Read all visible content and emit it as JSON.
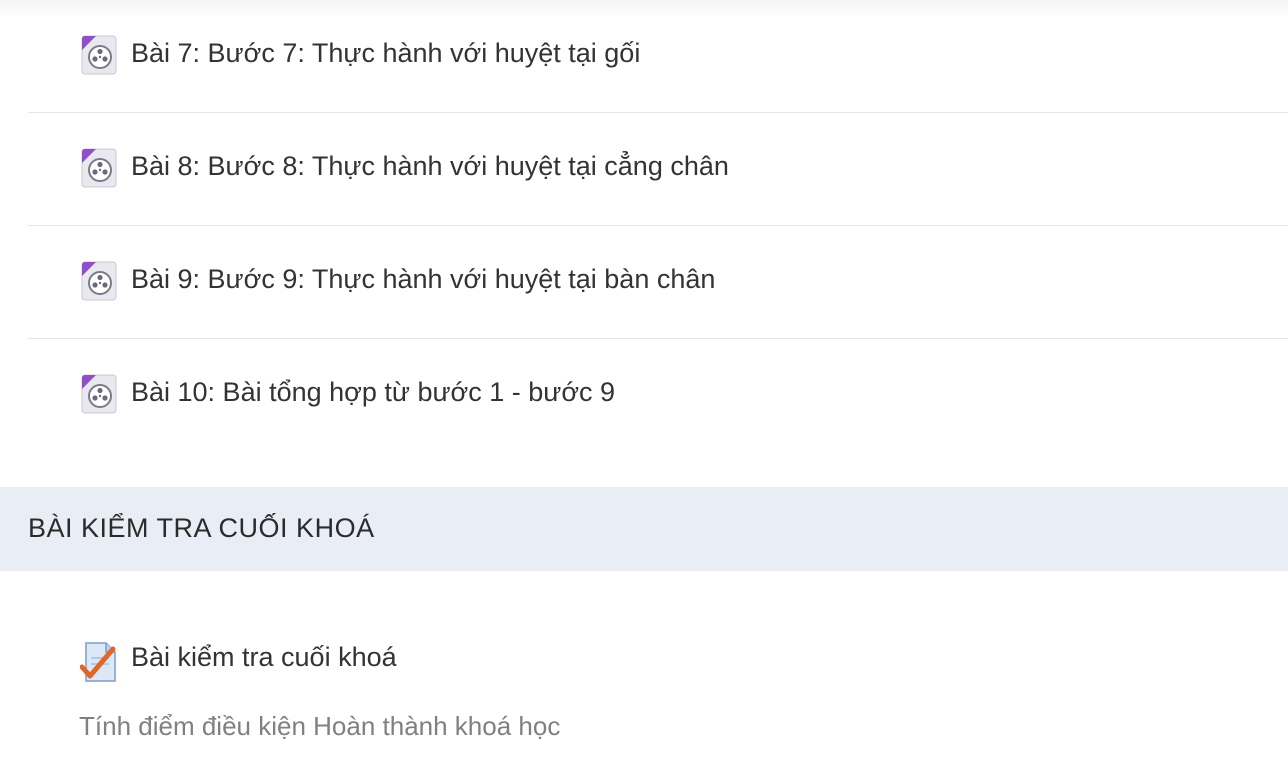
{
  "lessons": [
    {
      "label": "Bài 7: Bước 7: Thực hành với huyệt tại gối",
      "icon": "video-file-icon"
    },
    {
      "label": "Bài 8: Bước 8: Thực hành với huyệt tại cẳng chân",
      "icon": "video-file-icon"
    },
    {
      "label": "Bài 9: Bước 9: Thực hành với huyệt tại bàn chân",
      "icon": "video-file-icon"
    },
    {
      "label": "Bài 10: Bài tổng hợp từ bước 1 - bước 9",
      "icon": "video-file-icon"
    }
  ],
  "final_section": {
    "title": "BÀI KIỂM TRA CUỐI KHOÁ",
    "quiz": {
      "label": "Bài kiểm tra cuối khoá",
      "icon": "quiz-checkmark-icon",
      "description": "Tính điểm điều kiện Hoàn thành khoá học"
    }
  },
  "colors": {
    "section_header_bg": "#e9edf5",
    "text": "#333333",
    "muted_text": "#808080",
    "divider": "#e6e6e6",
    "icon_accent": "#8e4fc9",
    "check_accent": "#e0662a"
  }
}
